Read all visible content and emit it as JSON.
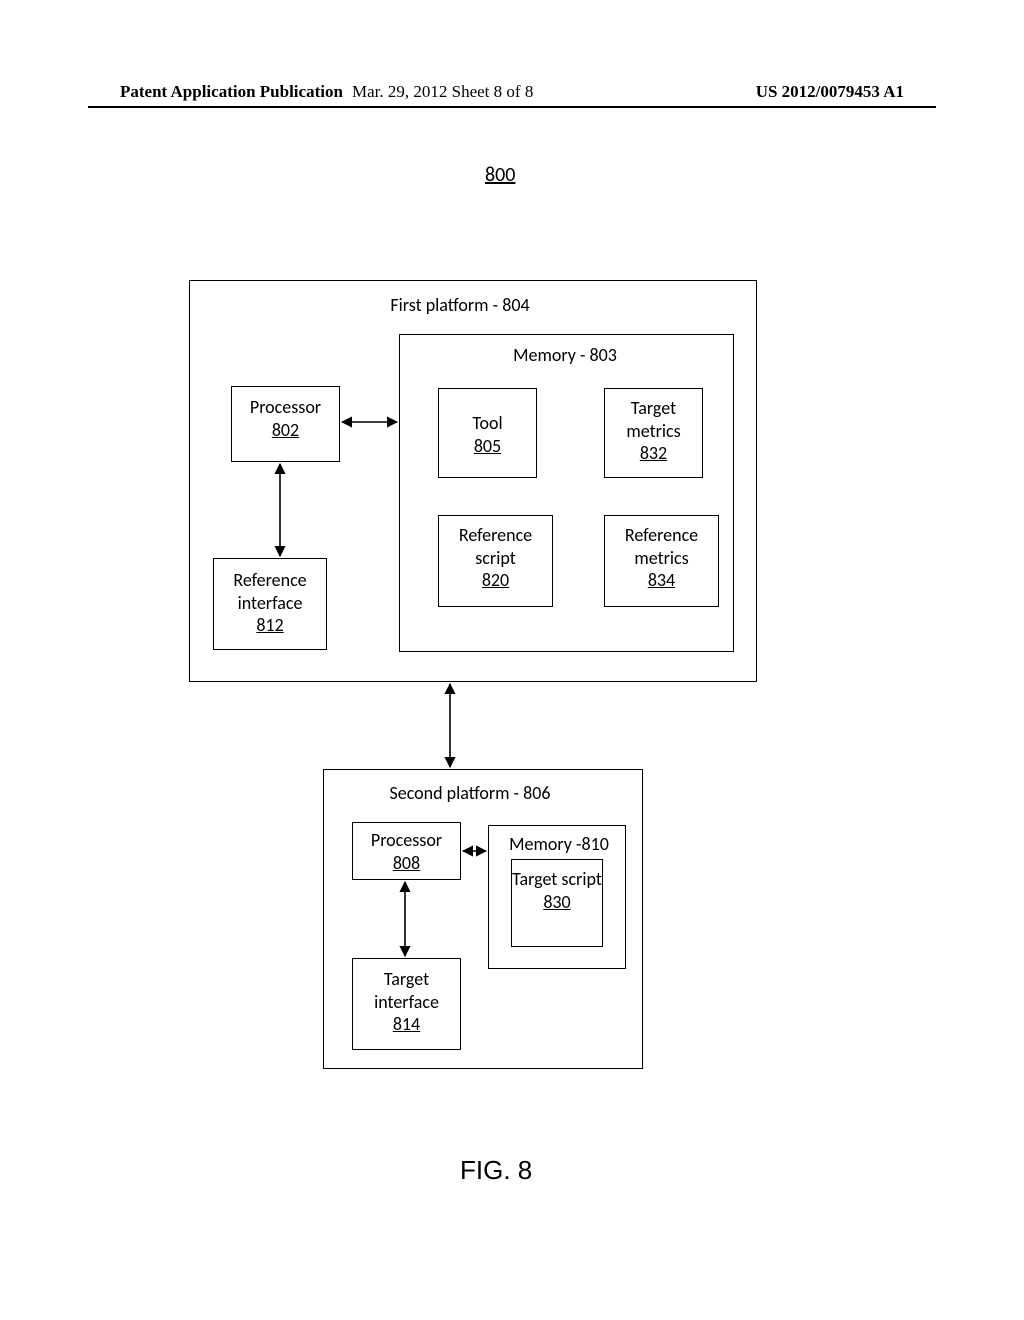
{
  "header": {
    "left": "Patent Application Publication",
    "center": "Mar. 29, 2012  Sheet 8 of 8",
    "right": "US 2012/0079453 A1"
  },
  "figure": {
    "number": "800",
    "caption": "FIG. 8"
  },
  "platform1": {
    "title": "First platform - 804",
    "processor": {
      "name": "Processor",
      "ref": "802"
    },
    "ref_interface": {
      "name": "Reference interface",
      "ref": "812"
    },
    "memory": {
      "title": "Memory - 803",
      "tool": {
        "name": "Tool",
        "ref": "805"
      },
      "target_metrics": {
        "name": "Target metrics",
        "ref": "832"
      },
      "ref_script": {
        "name": "Reference script",
        "ref": "820"
      },
      "ref_metrics": {
        "name": "Reference metrics",
        "ref": "834"
      }
    }
  },
  "platform2": {
    "title": "Second platform - 806",
    "processor": {
      "name": "Processor",
      "ref": "808"
    },
    "memory": {
      "title": "Memory -810",
      "target_script": {
        "name": "Target script",
        "ref": "830"
      }
    },
    "target_interface": {
      "name": "Target interface",
      "ref": "814"
    }
  }
}
